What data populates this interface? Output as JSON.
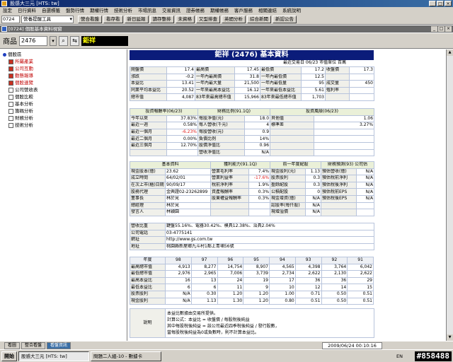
{
  "window": {
    "title": "股感大三元 [HTS: tw]",
    "controls": [
      "_",
      "□",
      "×"
    ]
  },
  "menu": [
    "設定",
    "日行資料",
    "自選標籤",
    "盤勢行情",
    "期權行情",
    "技術分析",
    "市場訊息",
    "交易資訊",
    "證券帳務",
    "期權帳務",
    "客戶服務",
    "相關連結",
    "系統說明"
  ],
  "toolbar": {
    "code": "0724",
    "select": "營養提醒工具",
    "buttons": [
      "營合看盤",
      "看存看",
      "新日延報",
      "讀存整排",
      "未資格",
      "又型排查",
      "英間分析",
      "綜合新聞",
      "新認公告"
    ]
  },
  "inner_window": {
    "title": "[0724] 個股基本資料視窗",
    "controls": [
      "_",
      "□",
      "×"
    ]
  },
  "product": {
    "label": "商品",
    "code": "2476",
    "name": "鉅祥"
  },
  "tree": {
    "root": "個股區",
    "items": [
      {
        "label": "所屬產業",
        "red": true
      },
      {
        "label": "公司互動",
        "red": true
      },
      {
        "label": "動態報導",
        "red": true
      },
      {
        "label": "個股速覽",
        "red": true
      },
      {
        "label": "公司營收表",
        "red": false
      },
      {
        "label": "個股比較",
        "red": false
      },
      {
        "label": "基本分析",
        "red": false
      },
      {
        "label": "籌碼分析",
        "red": false
      },
      {
        "label": "財務分析",
        "red": false
      },
      {
        "label": "技術分析",
        "red": false
      }
    ]
  },
  "main": {
    "title": "鉅祥 (2476) 基本資料",
    "subtitle": "最近交易日 06/23  市值單位 百萬"
  },
  "summary_rows": [
    [
      "開盤價",
      "17.4",
      "最高價",
      "17.45",
      "最低價",
      "17.2",
      "收盤價",
      "17.3"
    ],
    [
      "漲跌",
      "-0.2",
      "一年內最高價",
      "31.8",
      "一年內最低價",
      "12.5",
      "",
      ""
    ],
    [
      "本益比",
      "13.41",
      "一年內最大量",
      "21,500",
      "一年內最低量",
      "95",
      "成交量",
      "450"
    ],
    [
      "同業平均本益比",
      "20.52",
      "一年來最高本益比",
      "16.12",
      "一年來最低本益比",
      "5.61",
      "殖利率",
      ""
    ],
    [
      "總市值",
      "4,087",
      "83年來最高總市值",
      "15,966",
      "83年來最低總市值",
      "1,703",
      "",
      ""
    ]
  ],
  "perf": {
    "headers": [
      "投資報酬率(06/23)",
      "財務比例(91.1Q)",
      "投資風險(06/23)"
    ],
    "rows": [
      [
        "今年以來",
        "37.83%",
        "每股淨值(元)",
        "18.0",
        "貝他值",
        "1.06"
      ],
      [
        "最近一週",
        "0.58%",
        "每人營收(千元)",
        "4",
        "標準差",
        "3.27%"
      ],
      [
        "最近一個月",
        "-6.23%",
        "每股營收(元)",
        "0.9",
        "",
        ""
      ],
      [
        "最近二個月",
        "0.00%",
        "負債比例",
        "14%",
        "",
        ""
      ],
      [
        "最近三個月",
        "12.70%",
        "股價淨值比",
        "0.96",
        "",
        ""
      ],
      [
        "",
        "",
        "營收淨值比",
        "N/A",
        "",
        ""
      ]
    ]
  },
  "basic": {
    "headers": [
      "基本資料",
      "獲利能力(91.1Q)",
      "前一年度配股",
      "財務預測(93) 公司估"
    ],
    "rows": [
      [
        "現金股本(億)",
        "23.62",
        "營業毛利率",
        "7.4%",
        "現金股利(元)",
        "1.13",
        "預估營收(億)",
        "N/A"
      ],
      [
        "成立時間",
        "64/02/01",
        "營業利益率",
        "-17.6%",
        "股票股利",
        "0.3",
        "預估稅前淨利",
        "N/A"
      ],
      [
        "在次上市(櫃)日期",
        "90/09/17",
        "稅前淨利率",
        "1.9%",
        "盈餘配股",
        "0.3",
        "預估稅後淨利",
        "N/A"
      ],
      [
        "股務代理",
        "金興證02-23262899",
        "資產報酬率",
        "0.3%",
        "公積配股",
        "0",
        "預估稅前EPS",
        "N/A"
      ],
      [
        "董事長",
        "林於見",
        "股東權益報酬率",
        "0.3%",
        "現金增資(億)",
        "N/A",
        "預估稅後EPS",
        "N/A"
      ],
      [
        "總經理",
        "林於見",
        "",
        "",
        "認股率(每仟股)",
        "N/A",
        "",
        ""
      ],
      [
        "發言人",
        "林穎園",
        "",
        "",
        "現增溢價",
        "N/A",
        "",
        ""
      ]
    ]
  },
  "info": [
    [
      "營收比重",
      "鍵盤55.16%、電器30.42%、模具12.38%、治具2.04%"
    ],
    [
      "公司電話",
      "03-4775141"
    ],
    [
      "網址",
      "http://www.gs.com.tw"
    ],
    [
      "地址",
      "桃園縣新屋鄉九斗村1鄰上青埔56號"
    ]
  ],
  "yearly": {
    "header": [
      "年度",
      "98",
      "97",
      "96",
      "95",
      "94",
      "93",
      "92",
      "91"
    ],
    "rows": [
      [
        "最高總市值",
        "4,913",
        "8,277",
        "14,754",
        "8,907",
        "4,565",
        "4,398",
        "3,764",
        "6,042"
      ],
      [
        "最低總市值",
        "2,976",
        "2,965",
        "7,006",
        "3,739",
        "2,734",
        "2,622",
        "2,130",
        "2,622"
      ],
      [
        "最高本益比",
        "16",
        "13",
        "24",
        "19",
        "17",
        "36",
        "36",
        "29"
      ],
      [
        "最低本益比",
        "6",
        "6",
        "11",
        "9",
        "10",
        "12",
        "14",
        "15"
      ],
      [
        "股票股利",
        "N/A",
        "0.30",
        "1.20",
        "1.20",
        "1.00",
        "0.71",
        "0.50",
        "0.51"
      ],
      [
        "現金股利",
        "N/A",
        "1.13",
        "1.30",
        "1.20",
        "0.80",
        "0.51",
        "0.50",
        "0.51"
      ]
    ]
  },
  "notes": {
    "label": "說明",
    "lines": [
      "本益比數據由交易所提供。",
      "計算公式：本益比 = 收盤價 / 每股稅後純益",
      "其中每股稅後純益 = 該公司最近四季稅後純益 / 發行股數，",
      "當每股稅後純益為0或負數時，則不計算本益比。"
    ]
  },
  "status": {
    "tabs": [
      "看圖",
      "整合看盤",
      "看盤資訊"
    ],
    "active": 2,
    "clock": "2009/06/24 00:10:16"
  },
  "taskbar": {
    "start": "開始",
    "tasks": [
      "股感大三元 [HTS: tw]",
      "問題二人組-10 - 數據卡"
    ],
    "tray": "EN",
    "watermark": "#858488"
  }
}
